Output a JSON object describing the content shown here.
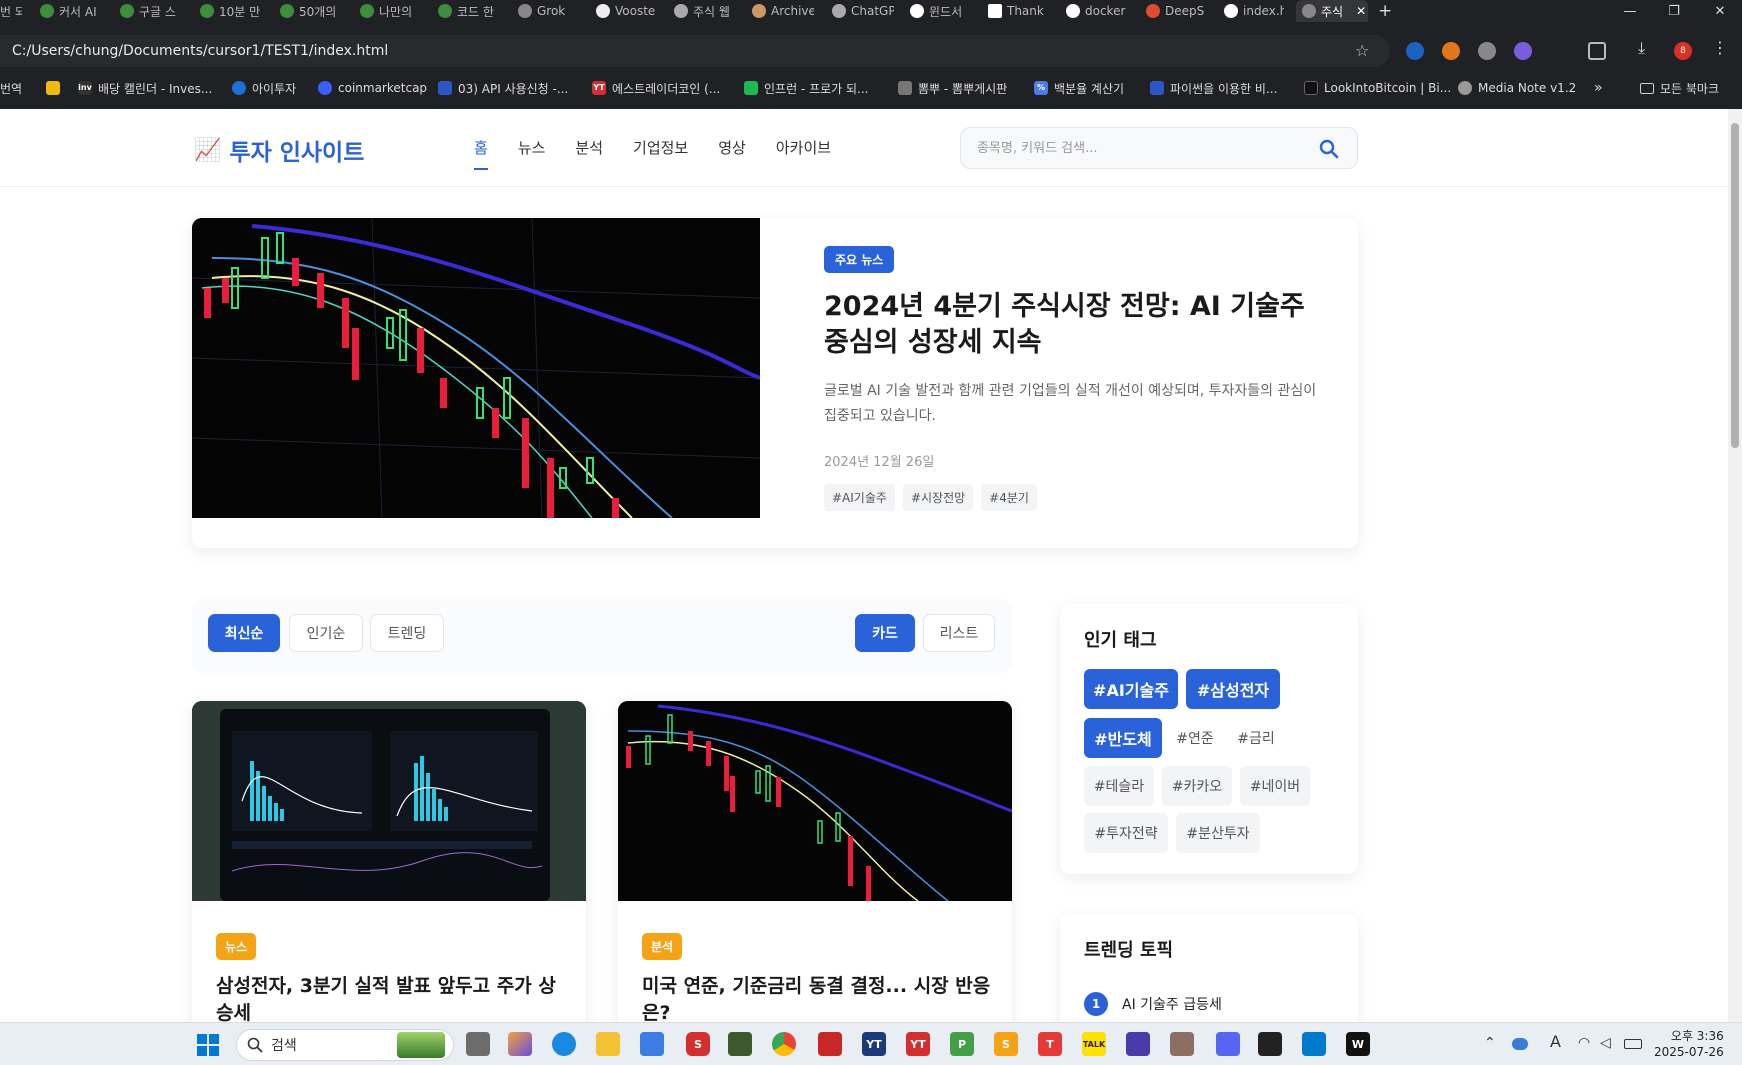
{
  "browser": {
    "tabs": [
      {
        "label": "번 되"
      },
      {
        "label": "커서 AI"
      },
      {
        "label": "구글 스"
      },
      {
        "label": "10분 만"
      },
      {
        "label": "50개의"
      },
      {
        "label": "나만의"
      },
      {
        "label": "코드 한"
      },
      {
        "label": "Grok"
      },
      {
        "label": "Vooste"
      },
      {
        "label": "주식 웹"
      },
      {
        "label": "Archive"
      },
      {
        "label": "ChatGP"
      },
      {
        "label": "윈드서"
      },
      {
        "label": "Thank"
      },
      {
        "label": "docker"
      },
      {
        "label": "DeepS"
      },
      {
        "label": "index.h"
      },
      {
        "label": "주식"
      }
    ],
    "new_tab": "+",
    "url": "C:/Users/chung/Documents/cursor1/TEST1/index.html",
    "profile_badge": "8",
    "bookmarks": [
      {
        "label": "번역"
      },
      {
        "label": "배당 캘린더 - Inves..."
      },
      {
        "label": "아이투자"
      },
      {
        "label": "coinmarketcap"
      },
      {
        "label": "03) API 사용신청 -..."
      },
      {
        "label": "에스트레이더코인 (..."
      },
      {
        "label": "인프런 - 프로가 되..."
      },
      {
        "label": "뽐뿌 - 뽐뿌게시판"
      },
      {
        "label": "백분율 계산기"
      },
      {
        "label": "파이썬을 이용한 비..."
      },
      {
        "label": "LookIntoBitcoin | Bi..."
      },
      {
        "label": "Media Note v1.2"
      }
    ],
    "bookmarks_more": "»",
    "all_bookmarks": "모든 북마크"
  },
  "site": {
    "logo_emoji": "📈",
    "logo": "투자 인사이트",
    "nav": [
      {
        "label": "홈"
      },
      {
        "label": "뉴스"
      },
      {
        "label": "분석"
      },
      {
        "label": "기업정보"
      },
      {
        "label": "영상"
      },
      {
        "label": "아카이브"
      }
    ],
    "search_placeholder": "종목명, 키워드 검색...",
    "hero": {
      "badge": "주요 뉴스",
      "title": "2024년 4분기 주식시장 전망: AI 기술주 중심의 성장세 지속",
      "desc": "글로벌 AI 기술 발전과 함께 관련 기업들의 실적 개선이 예상되며, 투자자들의 관심이 집중되고 있습니다.",
      "date": "2024년 12월 26일",
      "tags": [
        "#AI기술주",
        "#시장전망",
        "#4분기"
      ]
    },
    "sort": {
      "latest": "최신순",
      "popular": "인기순",
      "trending": "트렌딩"
    },
    "view": {
      "card": "카드",
      "list": "리스트"
    },
    "cards": [
      {
        "badge": "뉴스",
        "title": "삼성전자, 3분기 실적 발표 앞두고 주가 상승세"
      },
      {
        "badge": "분석",
        "title": "미국 연준, 기준금리 동결 결정... 시장 반응은?"
      }
    ],
    "popular_tags": {
      "title": "인기 태그",
      "items": [
        "#AI기술주",
        "#삼성전자",
        "#반도체",
        "#연준",
        "#금리",
        "#테슬라",
        "#카카오",
        "#네이버",
        "#투자전략",
        "#분산투자"
      ]
    },
    "trending": {
      "title": "트렌딩 토픽",
      "items": [
        {
          "num": "1",
          "label": "AI 기술주 급등세"
        }
      ]
    }
  },
  "taskbar": {
    "search": "검색",
    "time": "오후 3:36",
    "date": "2025-07-26",
    "ime": "A"
  }
}
